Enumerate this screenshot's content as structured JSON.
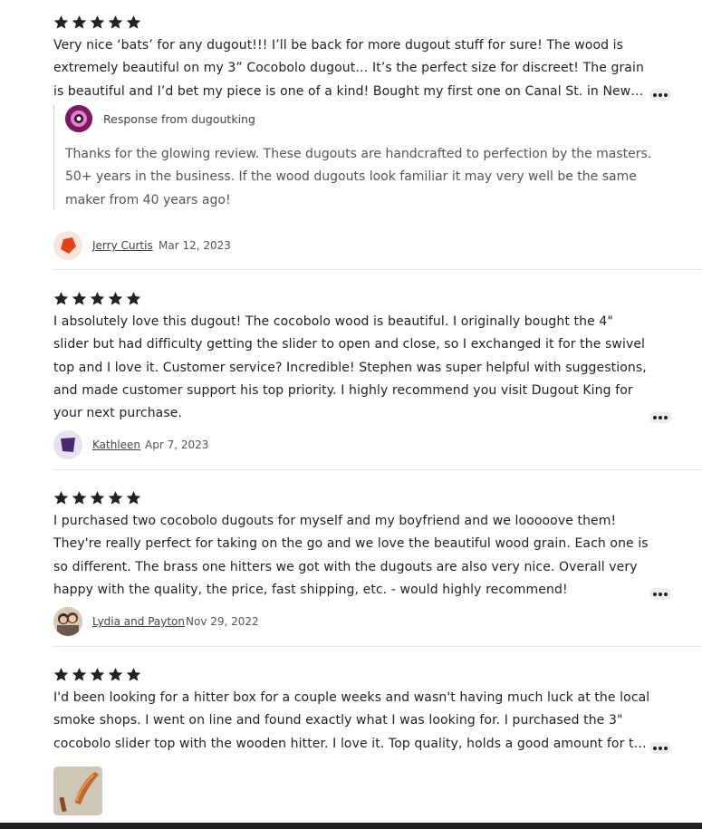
{
  "reviews": [
    {
      "rating": 5,
      "text": "Very nice ‘bats’ for any dugout!!! I’ll be back for more dugout stuff for sure! The wood is extremely beautiful on my 3” Cocobolo dugout… It’s the perfect size for discreet! The grain is beautiful and I’d bet my piece is one of a kind! Bought my first one on Canal St. in New Orleans years ago.",
      "response": {
        "title": "Response from dugoutking",
        "text": "Thanks for the glowing review. These dugouts are handcrafted to perfection by the masters. 50+ years in the business. If the wood dugouts look familiar it may very well be the same maker from 40 years ago!"
      },
      "reviewer": "Jerry Curtis",
      "date": "Mar 12, 2023",
      "avatar_color": "#e0441c"
    },
    {
      "rating": 5,
      "text": "I absolutely love this dugout! The cocobolo wood is beautiful. I originally bought the 4\" slider but had difficulty getting the slider to open and close, so I exchanged it for the swivel top and I love it. Customer service? Incredible! Stephen was super helpful with suggestions, and made customer support his top priority. I highly recommend you visit Dugout King for your next purchase.",
      "reviewer": "Kathleen",
      "date": "Apr 7, 2023",
      "avatar_color": "#4b2a6e"
    },
    {
      "rating": 5,
      "text": "I purchased two cocobolo dugouts for myself and my boyfriend and we looooove them! They're really perfect for taking on the go and we love the beautiful wood grain. Each one is so different. The brass one hitters we got with the dugouts are also very nice. Overall very happy with the quality, the price, fast shipping, etc. - would highly recommend!",
      "reviewer": "Lydia and Payton",
      "date": "Nov 29, 2022"
    },
    {
      "rating": 5,
      "text": "I'd been looking for a hitter box for a couple weeks and wasn't having much luck at the local smoke shops. I went on line and found exactly what I was looking for. I purchased the 3\" cocobolo slider top with the wooden hitter. I love it. Top quality, holds a good amount for the day."
    }
  ]
}
